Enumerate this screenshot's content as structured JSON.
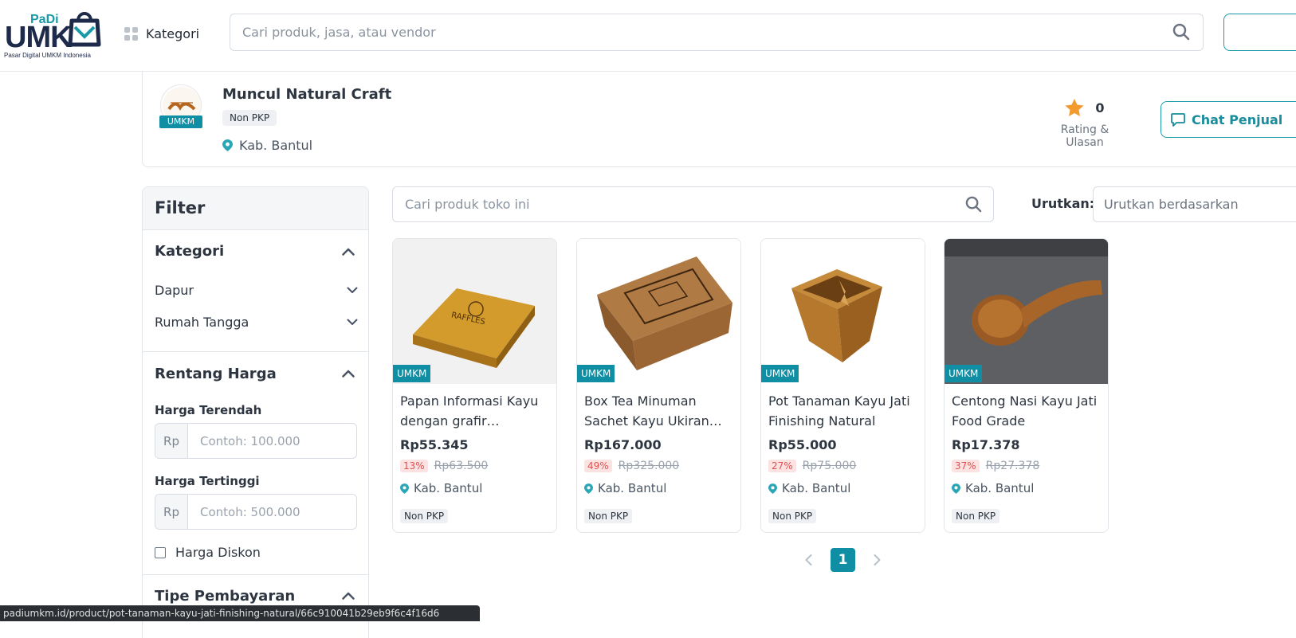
{
  "header": {
    "logo": {
      "brand_small": "PaDi",
      "brand_large": "UMK",
      "tagline": "Pasar Digital UMKM Indonesia"
    },
    "kategori_label": "Kategori",
    "search_placeholder": "Cari produk, jasa, atau vendor"
  },
  "store": {
    "name": "Muncul Natural Craft",
    "badge": "UMKM",
    "tax_status": "Non PKP",
    "location": "Kab. Bantul",
    "rating_value": "0",
    "rating_label": "Rating & Ulasan",
    "chat_label": "Chat Penjual"
  },
  "filter": {
    "title": "Filter",
    "kategori": {
      "title": "Kategori",
      "items": [
        "Dapur",
        "Rumah Tangga"
      ]
    },
    "price": {
      "title": "Rentang Harga",
      "min_label": "Harga Terendah",
      "min_prefix": "Rp",
      "min_placeholder": "Contoh: 100.000",
      "max_label": "Harga Tertinggi",
      "max_prefix": "Rp",
      "max_placeholder": "Contoh: 500.000",
      "discount_label": "Harga Diskon"
    },
    "payment": {
      "title": "Tipe Pembayaran"
    }
  },
  "products_area": {
    "search_placeholder": "Cari produk toko ini",
    "sort_label": "Urutkan:",
    "sort_placeholder": "Urutkan berdasarkan"
  },
  "products": [
    {
      "badge": "UMKM",
      "name": "Papan Informasi Kayu dengan grafir barcode…",
      "price": "Rp55.345",
      "discount": "13%",
      "original_price": "Rp63.500",
      "location": "Kab. Bantul",
      "tax_status": "Non PKP"
    },
    {
      "badge": "UMKM",
      "name": "Box Tea Minuman Sachet Kayu Ukiran…",
      "price": "Rp167.000",
      "discount": "49%",
      "original_price": "Rp325.000",
      "location": "Kab. Bantul",
      "tax_status": "Non PKP"
    },
    {
      "badge": "UMKM",
      "name": "Pot Tanaman Kayu Jati Finishing Natural",
      "price": "Rp55.000",
      "discount": "27%",
      "original_price": "Rp75.000",
      "location": "Kab. Bantul",
      "tax_status": "Non PKP"
    },
    {
      "badge": "UMKM",
      "name": "Centong Nasi Kayu Jati Food Grade",
      "price": "Rp17.378",
      "discount": "37%",
      "original_price": "Rp27.378",
      "location": "Kab. Bantul",
      "tax_status": "Non PKP"
    }
  ],
  "pagination": {
    "current": "1"
  },
  "status_bar": {
    "url": "padiumkm.id/product/pot-tanaman-kayu-jati-finishing-natural/66c910041b29eb9f6c4f16d6"
  },
  "colors": {
    "accent": "#0f8ea4",
    "brand_dark": "#1e2a4a",
    "discount_bg": "#fde2e2",
    "discount_text": "#e05252",
    "star": "#f29a2e"
  },
  "icons": [
    "grid-icon",
    "search-icon",
    "location-pin-icon",
    "star-icon",
    "chat-icon",
    "chevron-up-icon",
    "chevron-down-icon",
    "chevron-left-icon",
    "chevron-right-icon"
  ]
}
